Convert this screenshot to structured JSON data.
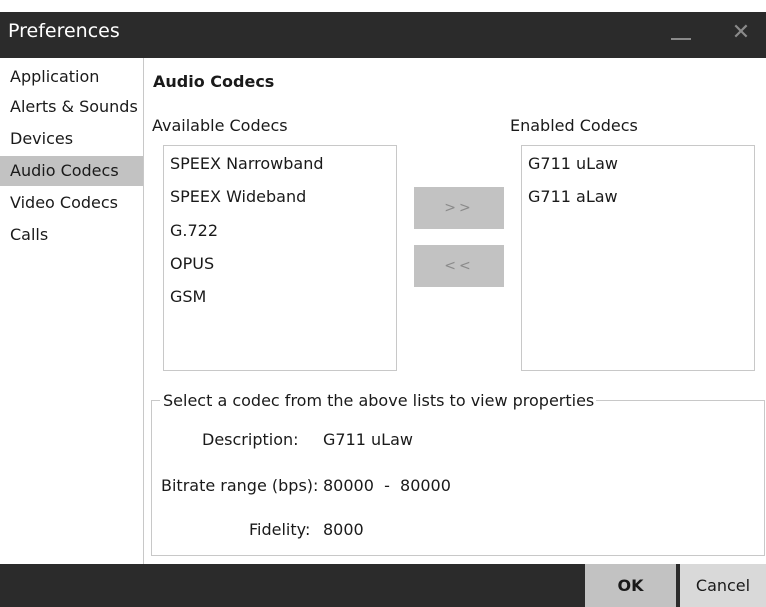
{
  "window": {
    "title": "Preferences",
    "minimize_icon": "minimize-icon",
    "close_icon": "close-icon"
  },
  "sidebar": {
    "items": [
      {
        "label": "Application",
        "active": false
      },
      {
        "label": "Alerts & Sounds",
        "active": false
      },
      {
        "label": "Devices",
        "active": false
      },
      {
        "label": "Audio Codecs",
        "active": true
      },
      {
        "label": "Video Codecs",
        "active": false
      },
      {
        "label": "Calls",
        "active": false
      }
    ]
  },
  "main": {
    "section_title": "Audio Codecs",
    "available": {
      "label": "Available Codecs",
      "items": [
        "SPEEX Narrowband",
        "SPEEX Wideband",
        "G.722",
        "OPUS",
        "GSM"
      ]
    },
    "enabled": {
      "label": "Enabled Codecs",
      "items": [
        "G711 uLaw",
        "G711 aLaw"
      ]
    },
    "buttons": {
      "add": ">>",
      "remove": "<<"
    },
    "properties": {
      "legend": "Select a codec from the above lists to view properties",
      "description_label": "Description:",
      "description_value": "G711 uLaw",
      "bitrate_label": "Bitrate range (bps):",
      "bitrate_value": "80000  -  80000",
      "fidelity_label": "Fidelity:",
      "fidelity_value": "8000"
    }
  },
  "footer": {
    "ok": "OK",
    "cancel": "Cancel"
  },
  "colors": {
    "titlebar": "#2b2b2b",
    "selected": "#c2c2c2",
    "border": "#c8c8c8"
  }
}
